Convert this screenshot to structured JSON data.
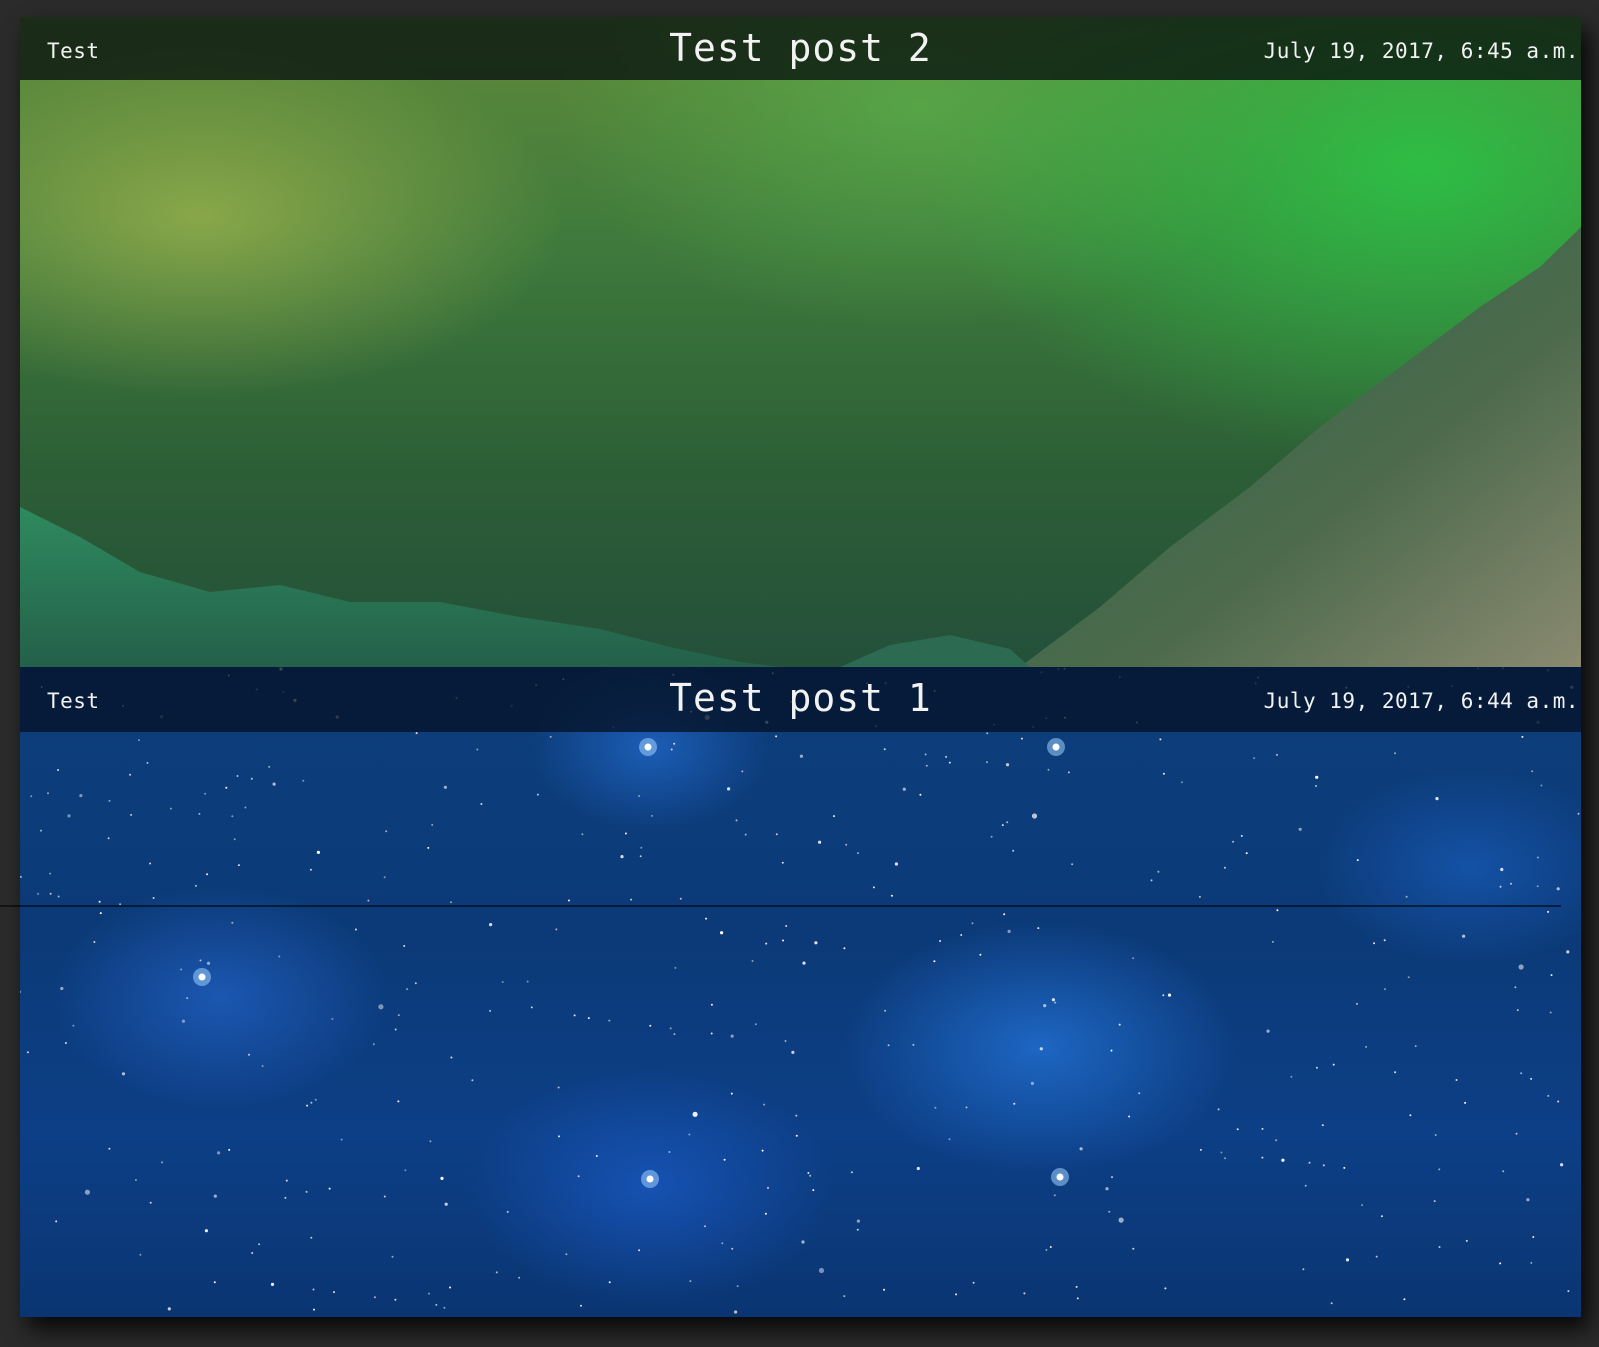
{
  "posts": [
    {
      "category": "Test",
      "title": "Test post 2",
      "date": "July 19, 2017, 6:45 a.m.",
      "background": "aurora-over-mountains"
    },
    {
      "category": "Test",
      "title": "Test post 1",
      "date": "July 19, 2017, 6:44 a.m.",
      "background": "blue-starfield"
    }
  ],
  "colors": {
    "page_background": "#2b2b2b",
    "header_text": "#f2f2f2",
    "aurora_green": "#3f7a3c",
    "space_blue": "#0d3e7c"
  }
}
